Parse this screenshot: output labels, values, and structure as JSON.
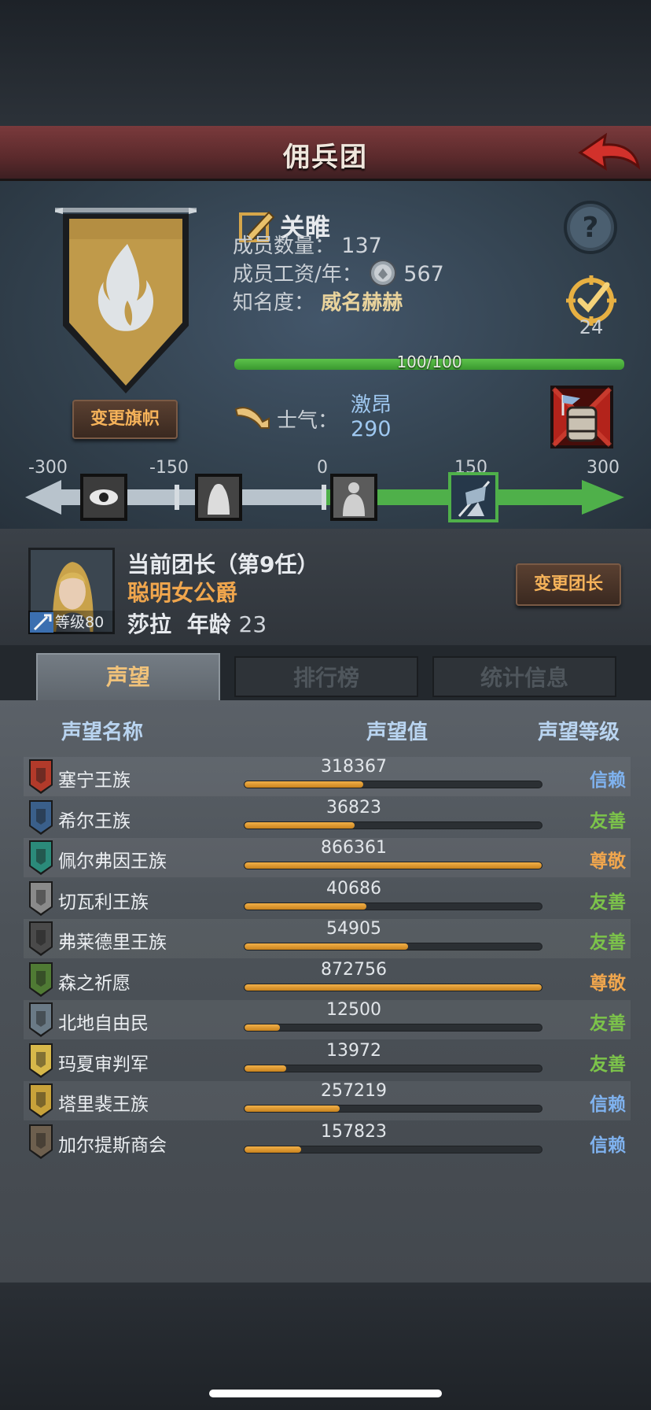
{
  "header": {
    "title": "佣兵团"
  },
  "guild": {
    "name": "关睢",
    "members_label": "成员数量：",
    "members_value": "137",
    "wage_label": "成员工资/年：",
    "wage_value": "567",
    "fame_label": "知名度：",
    "fame_value": "威名赫赫",
    "fame_progress_text": "100/100",
    "fame_progress": 1.0,
    "rank_number": "24",
    "change_banner_label": "变更旗帜"
  },
  "morale": {
    "label": "士气：",
    "state": "激昂",
    "value": "290",
    "scale": [
      "-300",
      "-150",
      "0",
      "150",
      "300"
    ],
    "current": 290
  },
  "captain": {
    "title": "当前团长（第9任）",
    "trait": "聪明女公爵",
    "name": "莎拉",
    "age_label": "年龄",
    "age_value": "23",
    "level_text": "等级80",
    "change_label": "变更团长"
  },
  "tabs": [
    {
      "label": "声望",
      "active": true
    },
    {
      "label": "排行榜",
      "active": false
    },
    {
      "label": "统计信息",
      "active": false
    }
  ],
  "reputation": {
    "col_name": "声望名称",
    "col_value": "声望值",
    "col_level": "声望等级",
    "rows": [
      {
        "name": "塞宁王族",
        "value": "318367",
        "level": "信赖",
        "progress": 0.4,
        "crest": "#b23a2a"
      },
      {
        "name": "希尔王族",
        "value": "36823",
        "level": "友善",
        "progress": 0.37,
        "crest": "#3a5f8a"
      },
      {
        "name": "佩尔弗因王族",
        "value": "866361",
        "level": "尊敬",
        "progress": 1.0,
        "crest": "#2b8a7a"
      },
      {
        "name": "切瓦利王族",
        "value": "40686",
        "level": "友善",
        "progress": 0.41,
        "crest": "#8a8a8a"
      },
      {
        "name": "弗莱德里王族",
        "value": "54905",
        "level": "友善",
        "progress": 0.55,
        "crest": "#4a4a4a"
      },
      {
        "name": "森之祈愿",
        "value": "872756",
        "level": "尊敬",
        "progress": 1.0,
        "crest": "#4f7a34"
      },
      {
        "name": "北地自由民",
        "value": "12500",
        "level": "友善",
        "progress": 0.12,
        "crest": "#6a7a86"
      },
      {
        "name": "玛夏审判军",
        "value": "13972",
        "level": "友善",
        "progress": 0.14,
        "crest": "#d7b84a"
      },
      {
        "name": "塔里裴王族",
        "value": "257219",
        "level": "信赖",
        "progress": 0.32,
        "crest": "#c8a23a"
      },
      {
        "name": "加尔提斯商会",
        "value": "157823",
        "level": "信赖",
        "progress": 0.19,
        "crest": "#6d5f4e"
      }
    ]
  },
  "colors": {
    "level_trust": "#7fb2ef",
    "level_friendly": "#7cc34a",
    "level_respect": "#f0a64d"
  }
}
